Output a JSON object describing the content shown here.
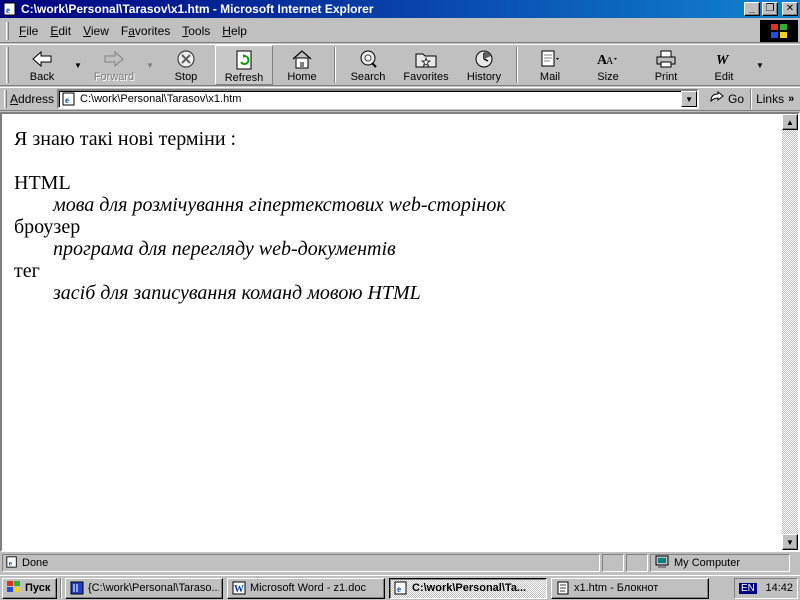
{
  "window": {
    "title": "C:\\work\\Personal\\Tarasov\\x1.htm - Microsoft Internet Explorer",
    "buttons": {
      "minimize": "_",
      "maximize": "❐",
      "close": "✕"
    }
  },
  "menubar": {
    "items": [
      {
        "key": "F",
        "rest": "ile"
      },
      {
        "key": "E",
        "rest": "dit"
      },
      {
        "key": "V",
        "rest": "iew"
      },
      {
        "prefix": "F",
        "key": "a",
        "rest": "vorites"
      },
      {
        "key": "T",
        "rest": "ools"
      },
      {
        "key": "H",
        "rest": "elp"
      }
    ]
  },
  "toolbar": {
    "back": "Back",
    "forward": "Forward",
    "stop": "Stop",
    "refresh": "Refresh",
    "home": "Home",
    "search": "Search",
    "favorites": "Favorites",
    "history": "History",
    "mail": "Mail",
    "size": "Size",
    "print": "Print",
    "edit": "Edit"
  },
  "address": {
    "label_key": "A",
    "label_rest": "ddress",
    "value": "C:\\work\\Personal\\Tarasov\\x1.htm",
    "go": "Go",
    "links": "Links"
  },
  "document": {
    "intro": "Я знаю такі нові терміни :",
    "terms": [
      {
        "term": "HTML",
        "definition": "мова для розмічування гіпертекстових web-сторінок"
      },
      {
        "term": "броузер",
        "definition": "програма для перегляду web-документів"
      },
      {
        "term": "тег",
        "definition": "засіб для записування команд мовою HTML"
      }
    ]
  },
  "statusbar": {
    "status": "Done",
    "zone": "My Computer"
  },
  "taskbar": {
    "start": "Пуск",
    "tasks": [
      {
        "label": "{C:\\work\\Personal\\Taraso...",
        "icon": "book-icon"
      },
      {
        "label": "Microsoft Word - z1.doc",
        "icon": "word-icon"
      },
      {
        "label": "C:\\work\\Personal\\Ta...",
        "icon": "ie-icon",
        "active": true
      },
      {
        "label": "x1.htm - Блокнот",
        "icon": "notepad-icon"
      }
    ],
    "lang": "EN",
    "clock": "14:42"
  },
  "colors": {
    "titlebar_start": "#000080",
    "titlebar_end": "#1084d0",
    "face": "#c0c0c0"
  }
}
